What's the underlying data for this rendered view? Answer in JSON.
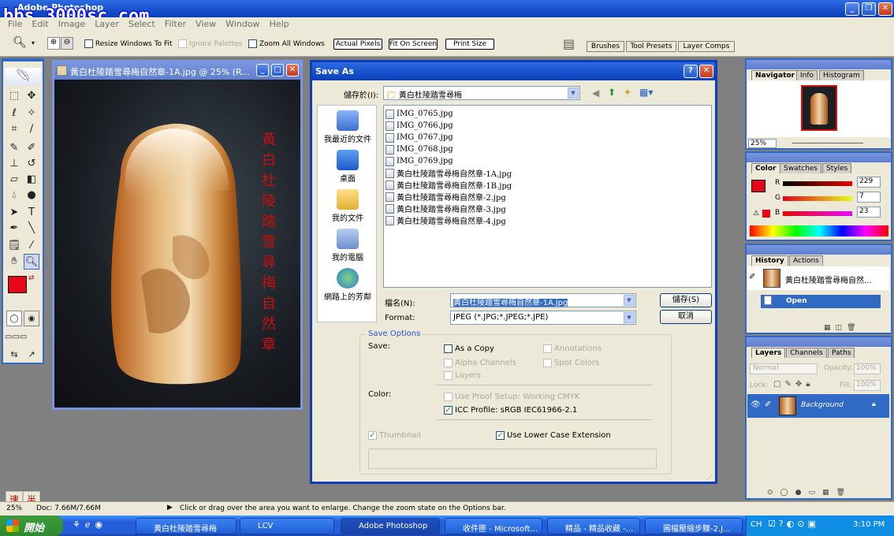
{
  "app": {
    "title": "Adobe Photoshop",
    "watermark": "bbs.3000sc.com",
    "menus": [
      "File",
      "Edit",
      "Image",
      "Layer",
      "Select",
      "Filter",
      "View",
      "Window",
      "Help"
    ]
  },
  "options_bar": {
    "resize_windows": "Resize Windows To Fit",
    "ignore_palettes": "Ignore Palettes",
    "zoom_all": "Zoom All Windows",
    "actual_pixels": "Actual Pixels",
    "fit_on_screen": "Fit On Screen",
    "print_size": "Print Size",
    "well_tabs": [
      "Brushes",
      "Tool Presets",
      "Layer Comps"
    ]
  },
  "document": {
    "title": "黃白杜陵踏雪尋梅自然章-1A.jpg @ 25% (R...",
    "poem": [
      "黃",
      "白",
      "杜",
      "陵",
      "踏",
      "雪",
      "尋",
      "梅",
      "自",
      "然",
      "章"
    ]
  },
  "dialog": {
    "title": "Save As",
    "save_in_label": "儲存於(I):",
    "save_in_value": "黃白杜陵踏雪尋梅",
    "places": [
      "我最近的文件",
      "桌面",
      "我的文件",
      "我的電腦",
      "網路上的芳鄰"
    ],
    "files": [
      "IMG_0765.jpg",
      "IMG_0766.jpg",
      "IMG_0767.jpg",
      "IMG_0768.jpg",
      "IMG_0769.jpg",
      "黃白杜陵踏雪尋梅自然章-1A.jpg",
      "黃白杜陵踏雪尋梅自然章-1B.jpg",
      "黃白杜陵踏雪尋梅自然章-2.jpg",
      "黃白杜陵踏雪尋梅自然章-3.jpg",
      "黃白杜陵踏雪尋梅自然章-4.jpg"
    ],
    "filename_label": "檔名(N):",
    "filename_value": "黃白杜陵踏雪尋梅自然章-1A.jpg",
    "format_label": "Format:",
    "format_value": "JPEG (*.JPG;*.JPEG;*.JPE)",
    "save_button": "儲存(S)",
    "cancel_button": "取消",
    "save_options": {
      "legend": "Save Options",
      "save_label": "Save:",
      "as_a_copy": "As a Copy",
      "annotations": "Annotations",
      "alpha_channels": "Alpha Channels",
      "spot_colors": "Spot Colors",
      "layers": "Layers",
      "color_label": "Color:",
      "use_proof": "Use Proof Setup:  Working CMYK",
      "icc_profile": "ICC Profile:  sRGB IEC61966-2.1",
      "thumbnail": "Thumbnail",
      "lower_case": "Use Lower Case Extension"
    }
  },
  "navigator": {
    "tabs": [
      "Navigator",
      "Info",
      "Histogram"
    ],
    "zoom": "25%"
  },
  "color": {
    "tabs": [
      "Color",
      "Swatches",
      "Styles"
    ],
    "r": "229",
    "g": "7",
    "b": "23",
    "r_label": "R",
    "g_label": "G",
    "b_label": "B",
    "fg_color": "#e50717"
  },
  "history": {
    "tabs": [
      "History",
      "Actions"
    ],
    "snapshot": "黃白杜陵踏雪尋梅自然...",
    "state": "Open"
  },
  "layers": {
    "tabs": [
      "Layers",
      "Channels",
      "Paths"
    ],
    "blend": "Normal",
    "opacity_label": "Opacity:",
    "opacity": "100%",
    "lock_label": "Lock:",
    "fill_label": "Fill:",
    "fill": "100%",
    "layer_name": "Background"
  },
  "status": {
    "zoom": "25%",
    "doc": "Doc: 7.66M/7.66M",
    "hint": "Click or drag over the area you want to enlarge. Change the zoom state on the Options bar.",
    "ime": [
      "速",
      "半"
    ]
  },
  "taskbar": {
    "start": "開始",
    "tasks": [
      "黃白杜陵踏雪尋梅",
      "LCV",
      "Adobe Photoshop",
      "收件匣 - Microsoft...",
      "精品 - 精品收藏 -...",
      "圖檔壓縮步驟-2.J..."
    ],
    "lang": "CH",
    "time": "3:10 PM"
  }
}
